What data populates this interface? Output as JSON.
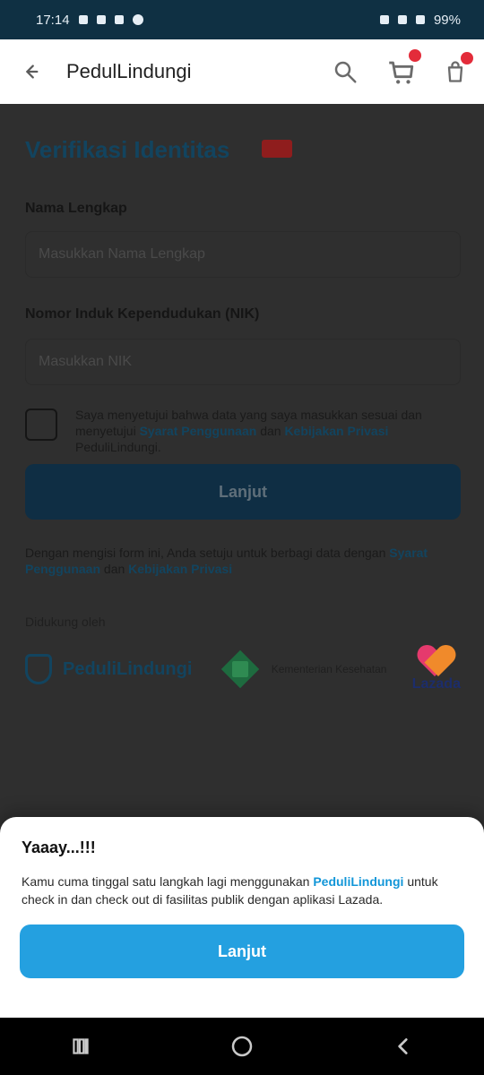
{
  "status_bar": {
    "time": "17:14",
    "battery": "99%"
  },
  "top_bar": {
    "title": "PedulLindungi"
  },
  "form": {
    "title": "Verifikasi Identitas",
    "name_label": "Nama Lengkap",
    "name_placeholder": "Masukkan Nama Lengkap",
    "nik_label": "Nomor Induk Kependudukan (NIK)",
    "nik_placeholder": "Masukkan NIK",
    "terms_text": "Saya menyetujui bahwa data yang saya masukkan sesuai dan menyetujui",
    "terms_link1": "Syarat Penggunaan",
    "terms_mid": "dan",
    "terms_link2": "Kebijakan Privasi",
    "terms_end": "PeduliLindungi.",
    "submit_label": "Lanjut",
    "disclaimer_text": "Dengan mengisi form ini, Anda setuju untuk berbagi data dengan",
    "disclaimer_link1": "Syarat Penggunaan",
    "disclaimer_mid": "dan",
    "disclaimer_link2": "Kebijakan Privasi",
    "supported_by": "Didukung oleh",
    "logo_pl": "PeduliLindungi",
    "logo_kemen": "Kementerian Kesehatan",
    "logo_laz": "Lazada"
  },
  "sheet": {
    "title": "Yaaay...!!!",
    "text_before": "Kamu cuma tinggal satu langkah lagi menggunakan",
    "brand": "PeduliLindungi",
    "text_after": "untuk check in dan check out di fasilitas publik dengan aplikasi Lazada.",
    "button": "Lanjut"
  },
  "colors": {
    "status_bar": "#0f3043",
    "primary_dark": "#0f2e44",
    "accent_blue": "#24a0e0",
    "badge": "#e32c3a"
  },
  "icons": [
    "back-arrow-icon",
    "search-icon",
    "cart-icon",
    "bag-icon",
    "recent-apps-icon",
    "home-icon",
    "back-nav-icon"
  ]
}
